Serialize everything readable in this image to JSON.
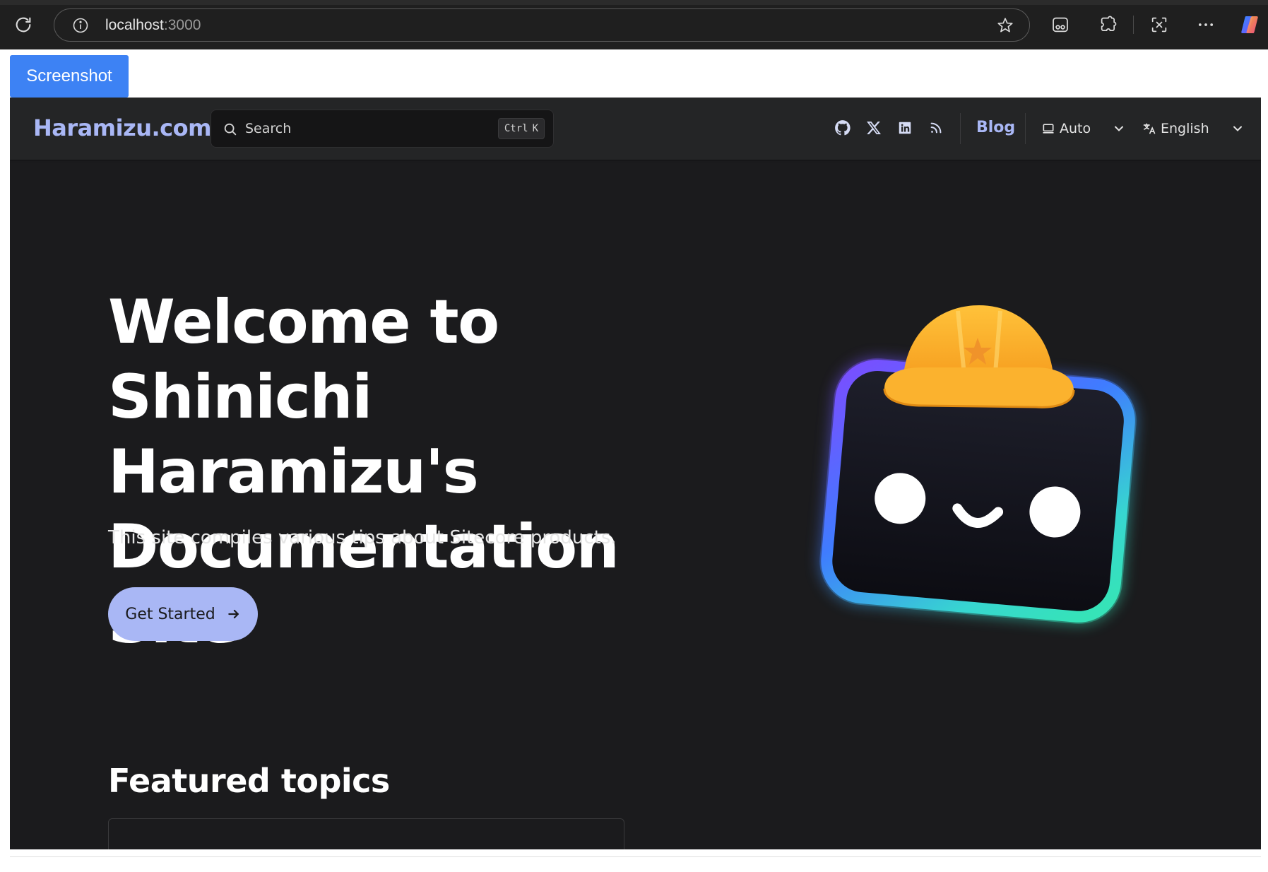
{
  "browser": {
    "url_host": "localhost",
    "url_port": ":3000"
  },
  "screenshot_button": {
    "label": "Screenshot"
  },
  "site": {
    "brand": "Haramizu.com",
    "search": {
      "placeholder": "Search",
      "kbd_ctrl": "Ctrl",
      "kbd_key": "K"
    },
    "nav": {
      "blog": "Blog",
      "theme": "Auto",
      "language": "English"
    },
    "hero": {
      "title": "Welcome to Shinichi Haramizu's Documentation Site",
      "subtitle": "This site compiles various tips about Sitecore products.",
      "cta": "Get Started"
    },
    "featured_heading": "Featured topics"
  },
  "colors": {
    "accent": "#a9b7f5",
    "background": "#1b1b1d",
    "navbar": "#242526",
    "screenshot_button": "#3d82f4"
  }
}
